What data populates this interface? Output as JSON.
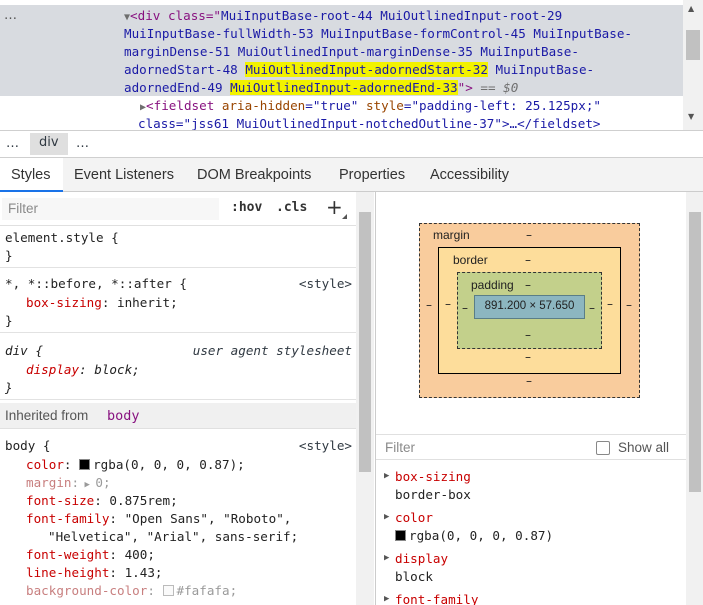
{
  "elements": {
    "dots": "…",
    "line1_open": "<div class=\"",
    "line1_classes": "MuiInputBase-root-44 MuiOutlinedInput-root-29",
    "line2": "MuiInputBase-fullWidth-53 MuiInputBase-formControl-45 MuiInputBase-",
    "line3": "marginDense-51 MuiOutlinedInput-marginDense-35 MuiInputBase-",
    "line4_a": "adornedStart-48 ",
    "line4_hl": "MuiOutlinedInput-adornedStart-32",
    "line4_b": " MuiInputBase-",
    "line5_a": "adornedEnd-49 ",
    "line5_hl": "MuiOutlinedInput-adornedEnd-33",
    "line5_close": "\">",
    "line5_eq": " == $0",
    "line6_tag": "<fieldset",
    "line6_attr1": " aria-hidden",
    "line6_val1": "=\"true\"",
    "line6_attr2": " style",
    "line6_val2": "=\"padding-left: 25.125px;\"",
    "line7": "class=\"jss61 MuiOutlinedInput-notchedOutline-37\">…</fieldset>"
  },
  "breadcrumb": {
    "left_dots": "…",
    "current": "div",
    "right_dots": "…"
  },
  "tabs": [
    "Styles",
    "Event Listeners",
    "DOM Breakpoints",
    "Properties",
    "Accessibility"
  ],
  "styles": {
    "filter_placeholder": "Filter",
    "hov": ":hov",
    "cls": ".cls",
    "plus": "+",
    "element_style": {
      "selector": "element.style {",
      "close": "}"
    },
    "rule_universal": {
      "selector": "*, *::before, *::after {",
      "source": "<style>",
      "prop": "box-sizing",
      "value": "inherit;",
      "close": "}"
    },
    "rule_div": {
      "selector": "div {",
      "source": "user agent stylesheet",
      "prop": "display",
      "value": "block;",
      "close": "}"
    },
    "inherited_label": "Inherited from",
    "inherited_from": "body",
    "rule_body": {
      "selector": "body {",
      "source": "<style>",
      "color_prop": "color",
      "color_val": "rgba(0, 0, 0, 0.87);",
      "margin_prop": "margin",
      "margin_val": "0;",
      "fontsize_prop": "font-size",
      "fontsize_val": "0.875rem;",
      "fontfamily_prop": "font-family",
      "fontfamily_val1": "\"Open Sans\", \"Roboto\",",
      "fontfamily_val2": "\"Helvetica\", \"Arial\", sans-serif;",
      "fontweight_prop": "font-weight",
      "fontweight_val": "400;",
      "lineheight_prop": "line-height",
      "lineheight_val": "1.43;",
      "bg_prop": "background-color",
      "bg_val": "#fafafa;"
    }
  },
  "boxmodel": {
    "margin_label": "margin",
    "border_label": "border",
    "padding_label": "padding",
    "dash": "–",
    "content_size": "891.200 × 57.650"
  },
  "computed": {
    "filter_placeholder": "Filter",
    "show_all": "Show all",
    "props": [
      {
        "name": "box-sizing",
        "value": "border-box"
      },
      {
        "name": "color",
        "value": "rgba(0, 0, 0, 0.87)"
      },
      {
        "name": "display",
        "value": "block"
      },
      {
        "name": "font-family",
        "value": ""
      }
    ]
  },
  "colors": {
    "accent": "#1a73e8",
    "highlight": "#f2f200",
    "swatch_black": "#000000",
    "swatch_bg": "#fafafa"
  }
}
